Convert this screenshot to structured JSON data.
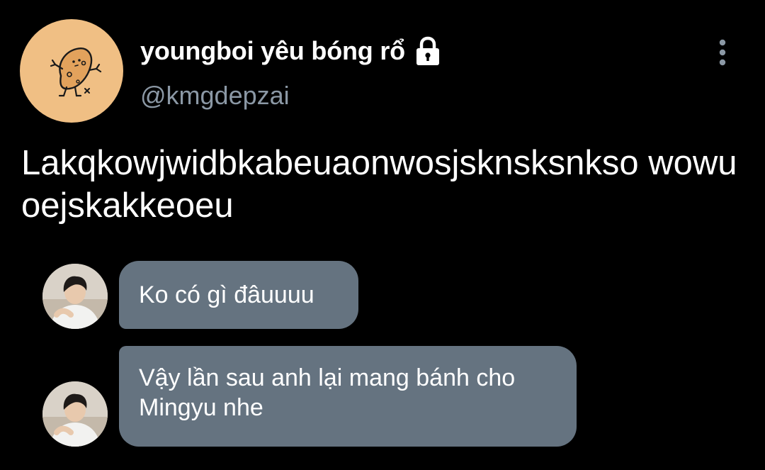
{
  "profile": {
    "display_name": "youngboi yêu bóng rổ",
    "handle": "@kmgdepzai",
    "lock_icon": "lock-icon",
    "avatar_icon": "potato-doodle-avatar",
    "avatar_bg": "#f0bf84"
  },
  "menu": {
    "icon": "more-vertical-icon"
  },
  "tweet": {
    "text": "Lakqkowjwidbkabeuaonwosjsknsksnkso wowuoejskakkeoeu"
  },
  "messages": [
    {
      "text": "Ko có gì đâuuuu"
    },
    {
      "text": "Vậy lần sau anh lại mang bánh cho Mingyu nhe"
    }
  ],
  "colors": {
    "background": "#000000",
    "handle": "#8b98a5",
    "bubble": "#657380",
    "text": "#ffffff"
  }
}
